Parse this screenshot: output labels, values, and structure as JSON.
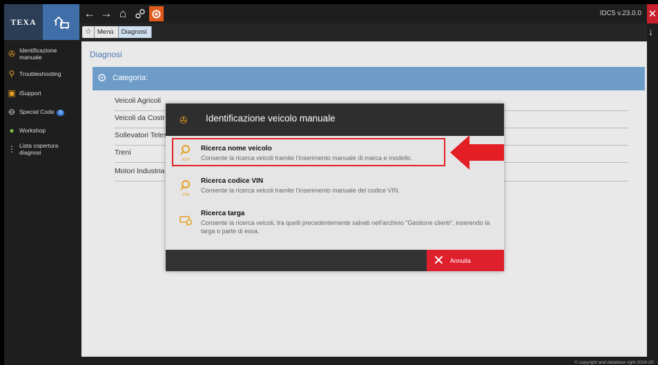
{
  "app": {
    "brand": "TEXA",
    "version": "IDC5 v.23.0.0"
  },
  "breadcrumb": [
    "Menù",
    "Diagnosi"
  ],
  "sidebar": {
    "items": [
      {
        "label": "Identificazione manuale",
        "icon": "vehicle-icon"
      },
      {
        "label": "Troubleshooting",
        "icon": "search-vin-icon"
      },
      {
        "label": "iSupport",
        "icon": "support-icon"
      },
      {
        "label": "Special Code",
        "icon": "lock-icon",
        "badge": "0"
      },
      {
        "label": "Workshop",
        "icon": "workshop-icon"
      },
      {
        "label": "Lista copertura diagnosi",
        "icon": "coverage-list-icon"
      }
    ]
  },
  "main": {
    "title": "Diagnosi",
    "category_label": "Categoria:",
    "categories": [
      "Veicoli Agricoli",
      "Veicoli da Costr",
      "Sollevatori Teles",
      "Treni",
      "Motori Industria"
    ]
  },
  "dialog": {
    "title": "Identificazione veicolo manuale",
    "options": [
      {
        "title": "Ricerca nome veicolo",
        "description": "Consente la ricerca veicoli tramite l'inserimento manuale di marca e modello.",
        "icon_text": "XXX",
        "highlighted": true
      },
      {
        "title": "Ricerca codice VIN",
        "description": "Consente la ricerca veicoli tramite l'inserimento manuale del codice VIN.",
        "icon_text": "VIN"
      },
      {
        "title": "Ricerca targa",
        "description": "Consente la ricerca veicoli, tra quelli precedentemente salvati nell'archivio \"Gestione clienti\", inserendo la targa o parte di essa."
      }
    ],
    "cancel_label": "Annulla"
  },
  "footer": {
    "copyright": "© copyright and database right 2016-20"
  },
  "colors": {
    "accent": "#3f6ea8",
    "category_bar": "#6e9cc9",
    "cancel": "#de1f2c",
    "highlight": "#e31e24",
    "icon_orange": "#e8a020"
  }
}
